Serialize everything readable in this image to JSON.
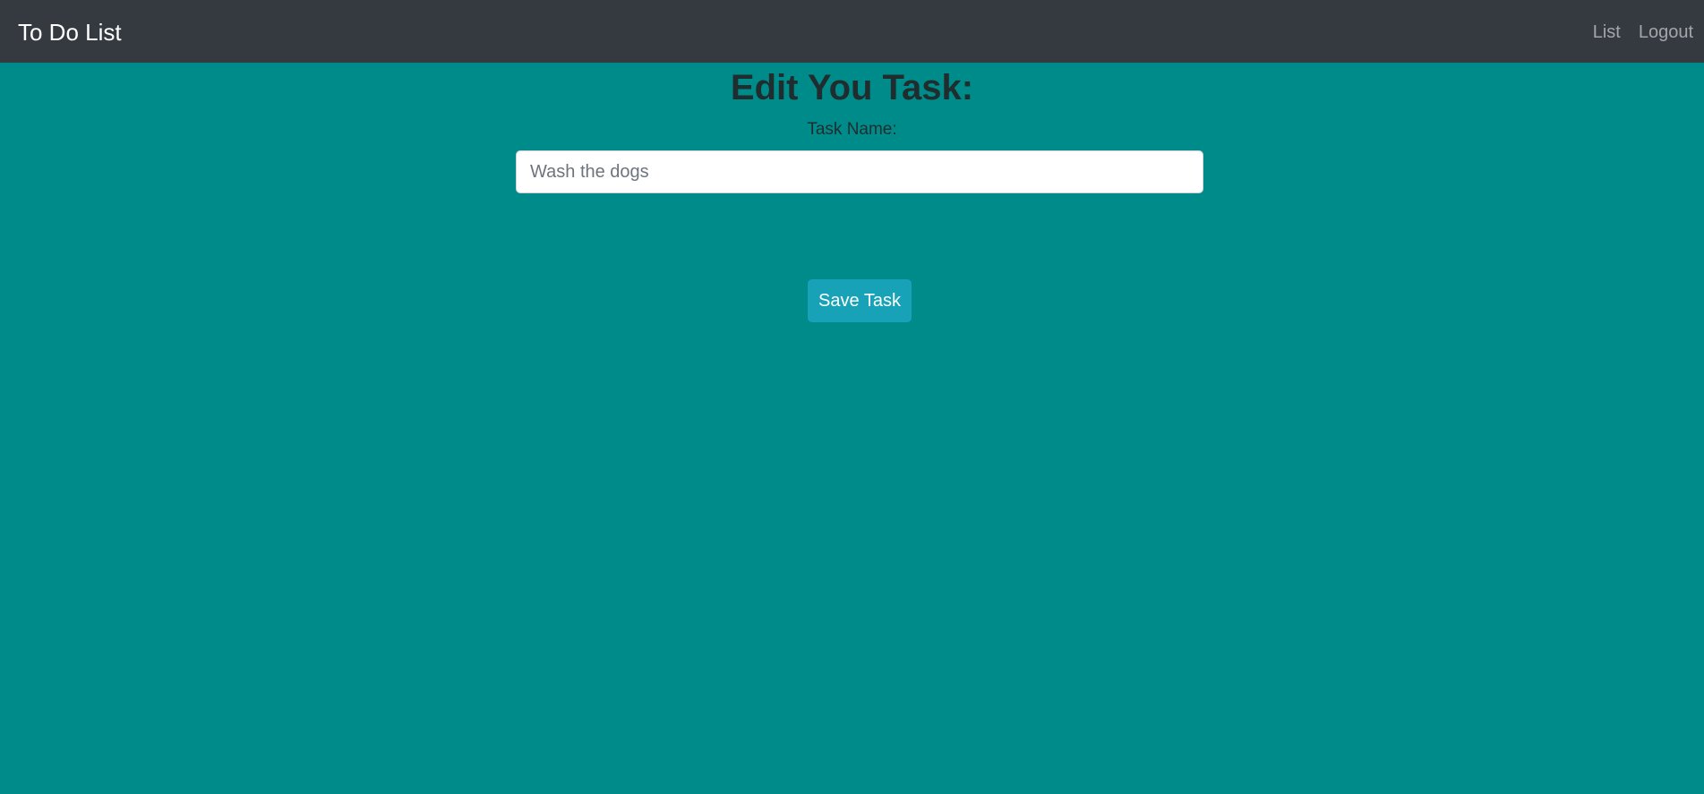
{
  "navbar": {
    "brand": "To Do List",
    "links": [
      {
        "label": "List"
      },
      {
        "label": "Logout"
      }
    ]
  },
  "main": {
    "title": "Edit You Task:",
    "task_field": {
      "label": "Task Name:",
      "value": "",
      "placeholder": "Wash the dogs"
    },
    "save_button_label": "Save Task"
  },
  "colors": {
    "navbar_bg": "#343a40",
    "page_bg": "#008b8b",
    "button_bg": "#17a2b8"
  }
}
